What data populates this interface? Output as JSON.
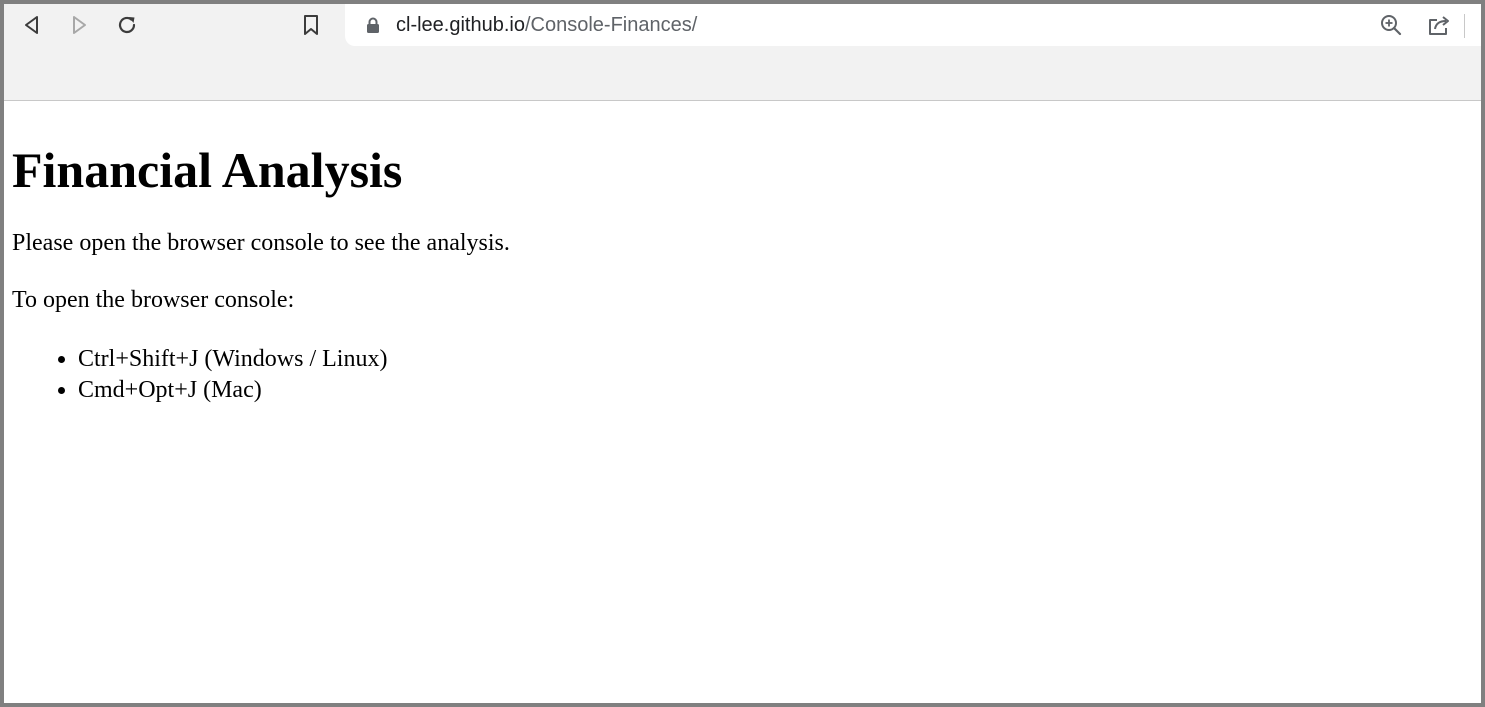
{
  "browser": {
    "url_host": "cl-lee.github.io",
    "url_path": "/Console-Finances/",
    "icons": {
      "back": "back-arrow-icon",
      "forward": "forward-arrow-icon",
      "reload": "reload-icon",
      "bookmark": "bookmark-icon",
      "lock": "lock-icon",
      "zoom": "zoom-in-icon",
      "share": "share-icon"
    }
  },
  "page": {
    "heading": "Financial Analysis",
    "intro": "Please open the browser console to see the analysis.",
    "instructions_label": "To open the browser console:",
    "shortcuts": [
      "Ctrl+Shift+J (Windows / Linux)",
      "Cmd+Opt+J (Mac)"
    ]
  }
}
